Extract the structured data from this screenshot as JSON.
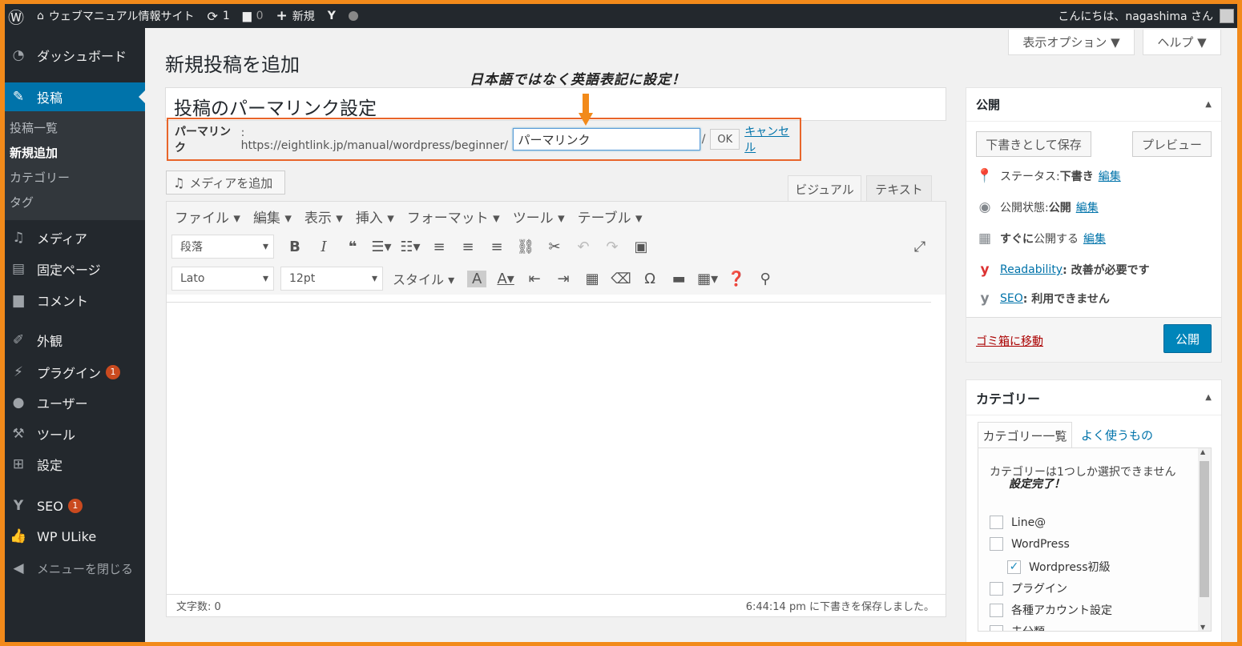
{
  "adminbar": {
    "site_name": "ウェブマニュアル情報サイト",
    "updates_count": "1",
    "comments_count": "0",
    "new_label": "新規",
    "greeting": "こんにちは、nagashima さん"
  },
  "sidebar": {
    "items": [
      {
        "icon": "dashboard-icon",
        "label": "ダッシュボード"
      },
      {
        "icon": "pin-icon",
        "label": "投稿"
      },
      {
        "icon": "media-icon",
        "label": "メディア"
      },
      {
        "icon": "page-icon",
        "label": "固定ページ"
      },
      {
        "icon": "comment-icon",
        "label": "コメント"
      },
      {
        "icon": "appearance-icon",
        "label": "外観"
      },
      {
        "icon": "plugin-icon",
        "label": "プラグイン",
        "badge": "1"
      },
      {
        "icon": "user-icon",
        "label": "ユーザー"
      },
      {
        "icon": "tool-icon",
        "label": "ツール"
      },
      {
        "icon": "settings-icon",
        "label": "設定"
      },
      {
        "icon": "yoast-icon",
        "label": "SEO",
        "badge": "1"
      },
      {
        "icon": "thumbs-up-icon",
        "label": "WP ULike"
      },
      {
        "icon": "collapse-icon",
        "label": "メニューを閉じる"
      }
    ],
    "submenu": [
      "投稿一覧",
      "新規追加",
      "カテゴリー",
      "タグ"
    ]
  },
  "screen_options": {
    "display_label": "表示オプション ▼",
    "help_label": "ヘルプ ▼"
  },
  "page_title": "新規投稿を追加",
  "annotation_top": "日本語ではなく英語表記に設定！",
  "post_title": "投稿のパーマリンク設定",
  "permalink": {
    "label": "パーマリンク",
    "base_url": ": https://eightlink.jp/manual/wordpress/beginner/",
    "slug": "パーマリンク",
    "trailing": "/",
    "ok": "OK",
    "cancel": "キャンセル"
  },
  "editor": {
    "add_media": "メディアを追加",
    "tab_visual": "ビジュアル",
    "tab_text": "テキスト",
    "menus": [
      "ファイル ▾",
      "編集 ▾",
      "表示 ▾",
      "挿入 ▾",
      "フォーマット ▾",
      "ツール ▾",
      "テーブル ▾"
    ],
    "format_select": "段落",
    "font_select": "Lato",
    "size_select": "12pt",
    "style_menu": "スタイル ▾",
    "word_count": "文字数: 0",
    "draft_saved": "6:44:14 pm に下書きを保存しました。"
  },
  "publish": {
    "title": "公開",
    "save_draft": "下書きとして保存",
    "preview": "プレビュー",
    "status_label": "ステータス: ",
    "status_value": "下書き",
    "visibility_label": "公開状態: ",
    "visibility_value": "公開",
    "schedule_label": "すぐに",
    "schedule_rest": "公開する",
    "edit": "編集",
    "readability_link": "Readability",
    "readability_value": ": 改善が必要です",
    "seo_link": "SEO",
    "seo_value": ": 利用できません",
    "trash": "ゴミ箱に移動",
    "publish_button": "公開"
  },
  "categories": {
    "title": "カテゴリー",
    "tab_all": "カテゴリー一覧",
    "tab_popular": "よく使うもの",
    "notice": "カテゴリーは1つしか選択できません",
    "notice_overlay": "設定完了！",
    "items": [
      {
        "label": "Line@",
        "checked": false
      },
      {
        "label": "WordPress",
        "checked": false
      },
      {
        "label": "Wordpress初級",
        "checked": true
      },
      {
        "label": "プラグイン",
        "checked": false
      },
      {
        "label": "各種アカウント設定",
        "checked": false
      },
      {
        "label": "未分類",
        "checked": false
      }
    ]
  },
  "colors": {
    "accent": "#0073aa",
    "highlight_border": "#e8652a",
    "frame": "#f28a1a"
  }
}
